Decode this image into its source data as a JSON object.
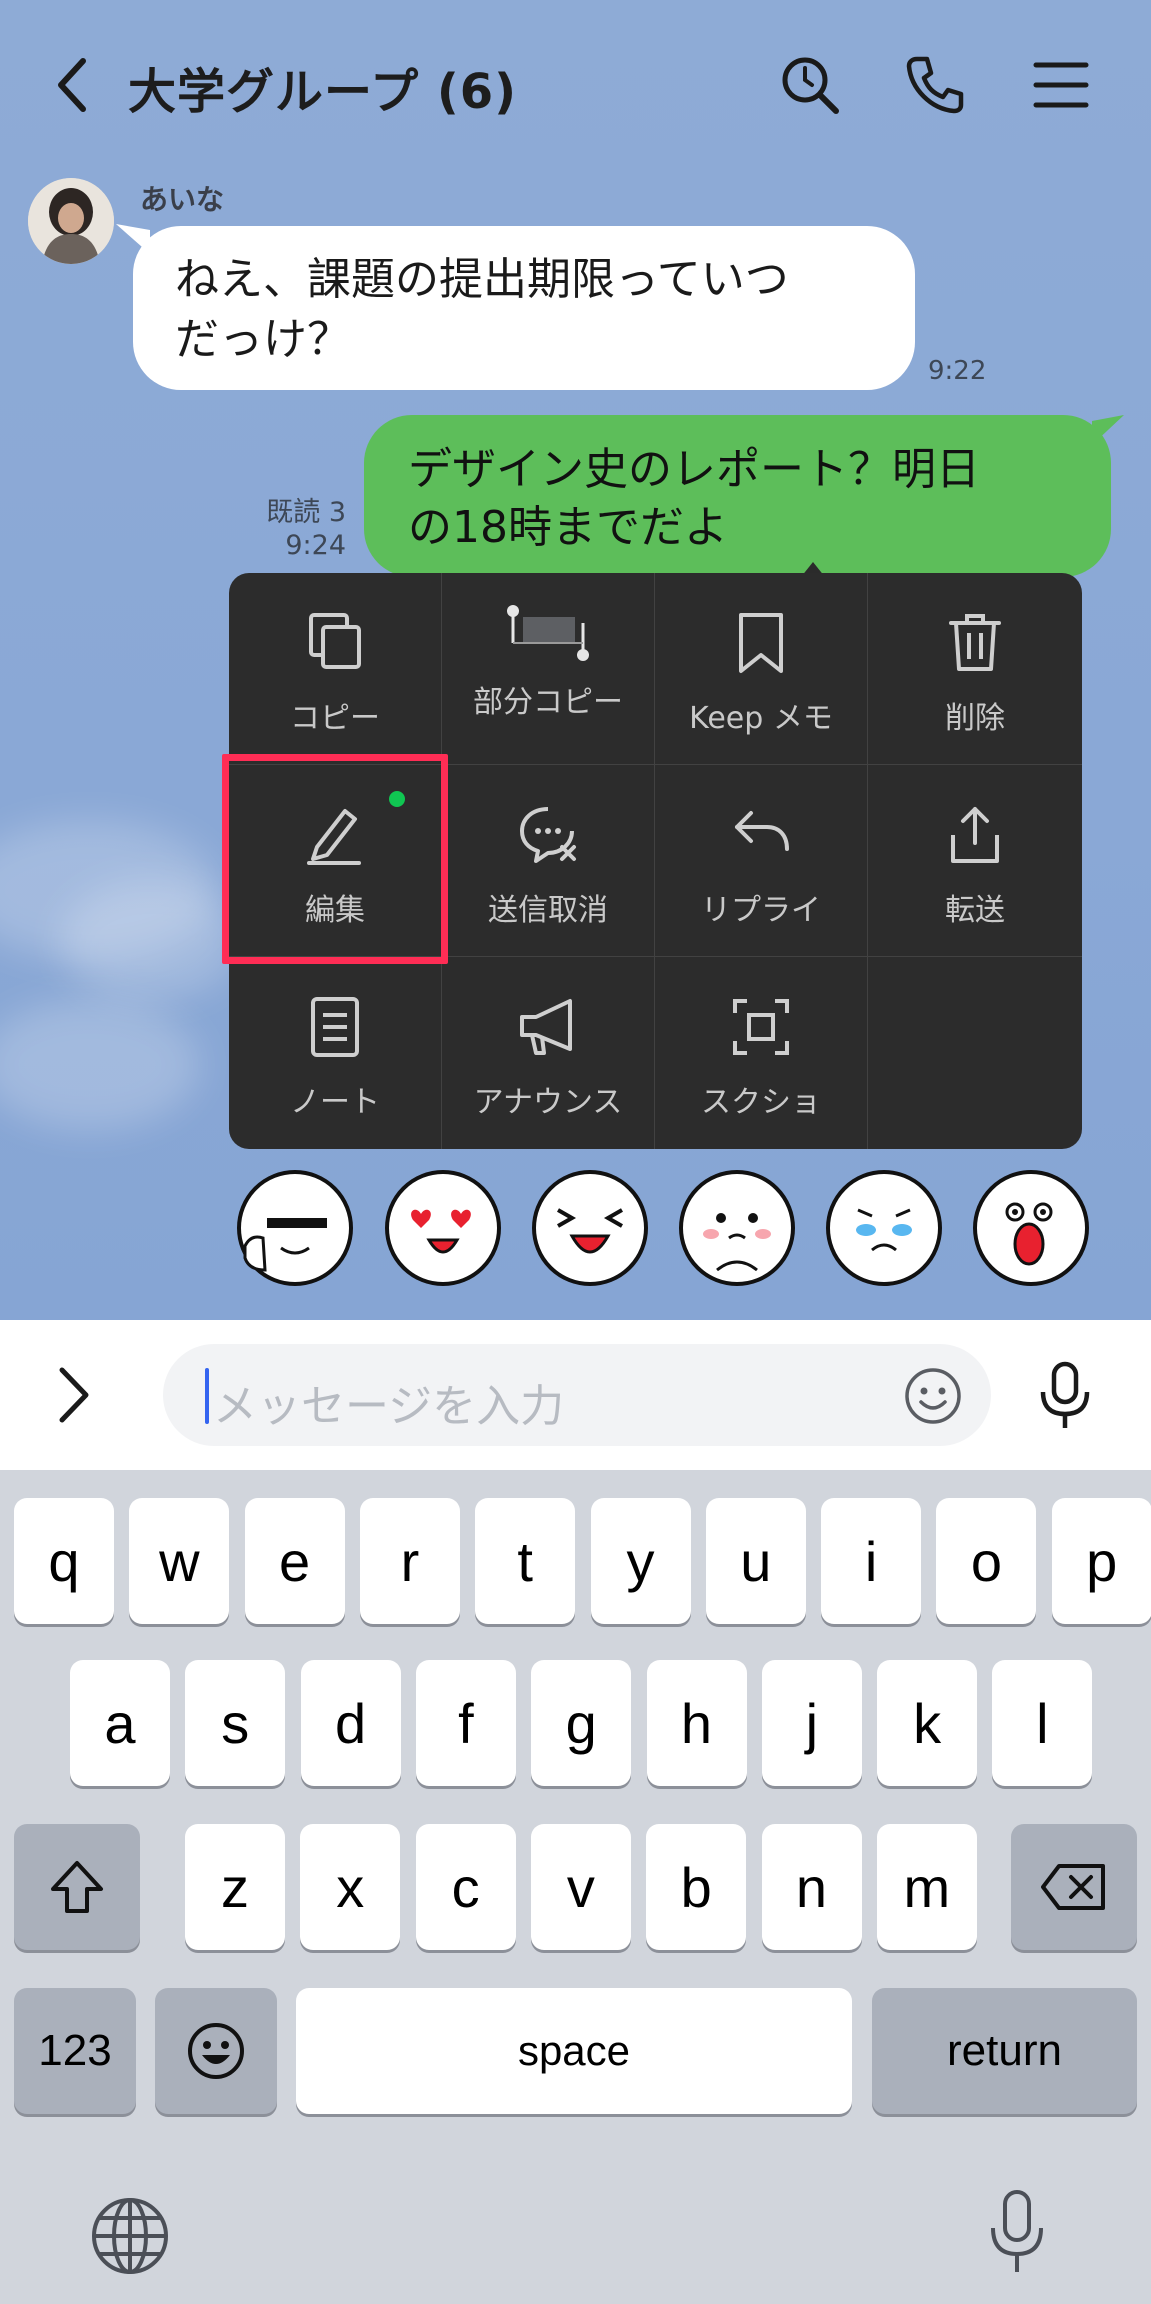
{
  "header": {
    "title": "大学グループ (6)"
  },
  "messages": {
    "incoming": {
      "sender": "あいな",
      "line1": "ねえ、課題の提出期限っていつ",
      "line2": "だっけ？",
      "time": "9:22"
    },
    "outgoing": {
      "line1": "デザイン史のレポート？明日",
      "line2": "の18時までだよ",
      "read_status": "既読 3",
      "time": "9:24"
    }
  },
  "context_menu": {
    "items": [
      {
        "label": "コピー",
        "icon": "copy-icon"
      },
      {
        "label": "部分コピー",
        "icon": "partial-copy-icon"
      },
      {
        "label": "Keep メモ",
        "icon": "bookmark-icon"
      },
      {
        "label": "削除",
        "icon": "trash-icon"
      },
      {
        "label": "編集",
        "icon": "pencil-icon"
      },
      {
        "label": "送信取消",
        "icon": "unsend-icon"
      },
      {
        "label": "リプライ",
        "icon": "reply-icon"
      },
      {
        "label": "転送",
        "icon": "share-icon"
      },
      {
        "label": "ノート",
        "icon": "note-icon"
      },
      {
        "label": "アナウンス",
        "icon": "megaphone-icon"
      },
      {
        "label": "スクショ",
        "icon": "screenshot-icon"
      }
    ],
    "highlight_color": "#ff2d55",
    "new_dot_color": "#10c652"
  },
  "stickers": [
    "thumbs-up-sticker",
    "heart-eyes-sticker",
    "laughing-sticker",
    "pleading-sticker",
    "crying-sticker",
    "shocked-sticker"
  ],
  "input": {
    "placeholder": "メッセージを入力"
  },
  "keyboard": {
    "row1": [
      "q",
      "w",
      "e",
      "r",
      "t",
      "y",
      "u",
      "i",
      "o",
      "p"
    ],
    "row2": [
      "a",
      "s",
      "d",
      "f",
      "g",
      "h",
      "j",
      "k",
      "l"
    ],
    "row3": [
      "z",
      "x",
      "c",
      "v",
      "b",
      "n",
      "m"
    ],
    "numbers_label": "123",
    "space_label": "space",
    "return_label": "return"
  },
  "colors": {
    "chat_background": "#8aa8d6",
    "outgoing_bubble": "#5dbe5a",
    "menu_background": "#2c2c2c",
    "keyboard_background": "#d1d5dc",
    "cursor": "#3464f0"
  }
}
